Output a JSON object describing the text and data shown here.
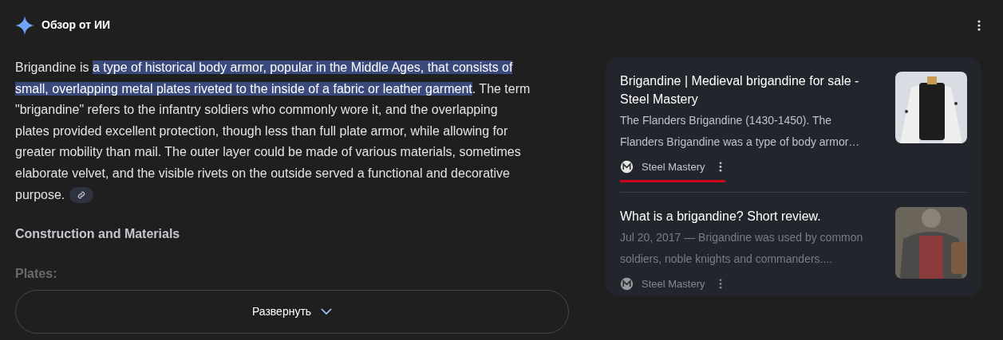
{
  "header": {
    "title": "Обзор от ИИ"
  },
  "paragraph": [
    {
      "text": "Brigandine is ",
      "highlighted": false
    },
    {
      "text": "a type of historical body armor, popular in the Middle Ages, that consists of small, overlapping metal plates riveted to the inside of a fabric or leather garment",
      "highlighted": true
    },
    {
      "text": ". The term \"brigandine\" refers to the infantry soldiers who commonly wore it, and the overlapping plates provided excellent protection, though less than full plate armor, while allowing for greater mobility than mail. The outer layer could be made of various materials, sometimes elaborate velvet, and the visible rivets on the outside served a functional and decorative purpose.",
      "highlighted": false
    }
  ],
  "section_heading": "Construction and Materials",
  "faded_subheading": "Plates:",
  "expand_button": "Развернуть",
  "sources": [
    {
      "title": "Brigandine | Medieval brigandine for sale - Steel Mastery",
      "snippet": "The Flanders Brigandine (1430-1450). The Flanders Brigandine was a type of body armor…",
      "site": "Steel Mastery",
      "underlined": true,
      "faded": false
    },
    {
      "title": "What is a brigandine? Short review.",
      "snippet": "Jul 20, 2017 — Brigandine was used by common soldiers, noble knights and commanders....",
      "site": "Steel Mastery",
      "underlined": false,
      "faded": true
    }
  ]
}
